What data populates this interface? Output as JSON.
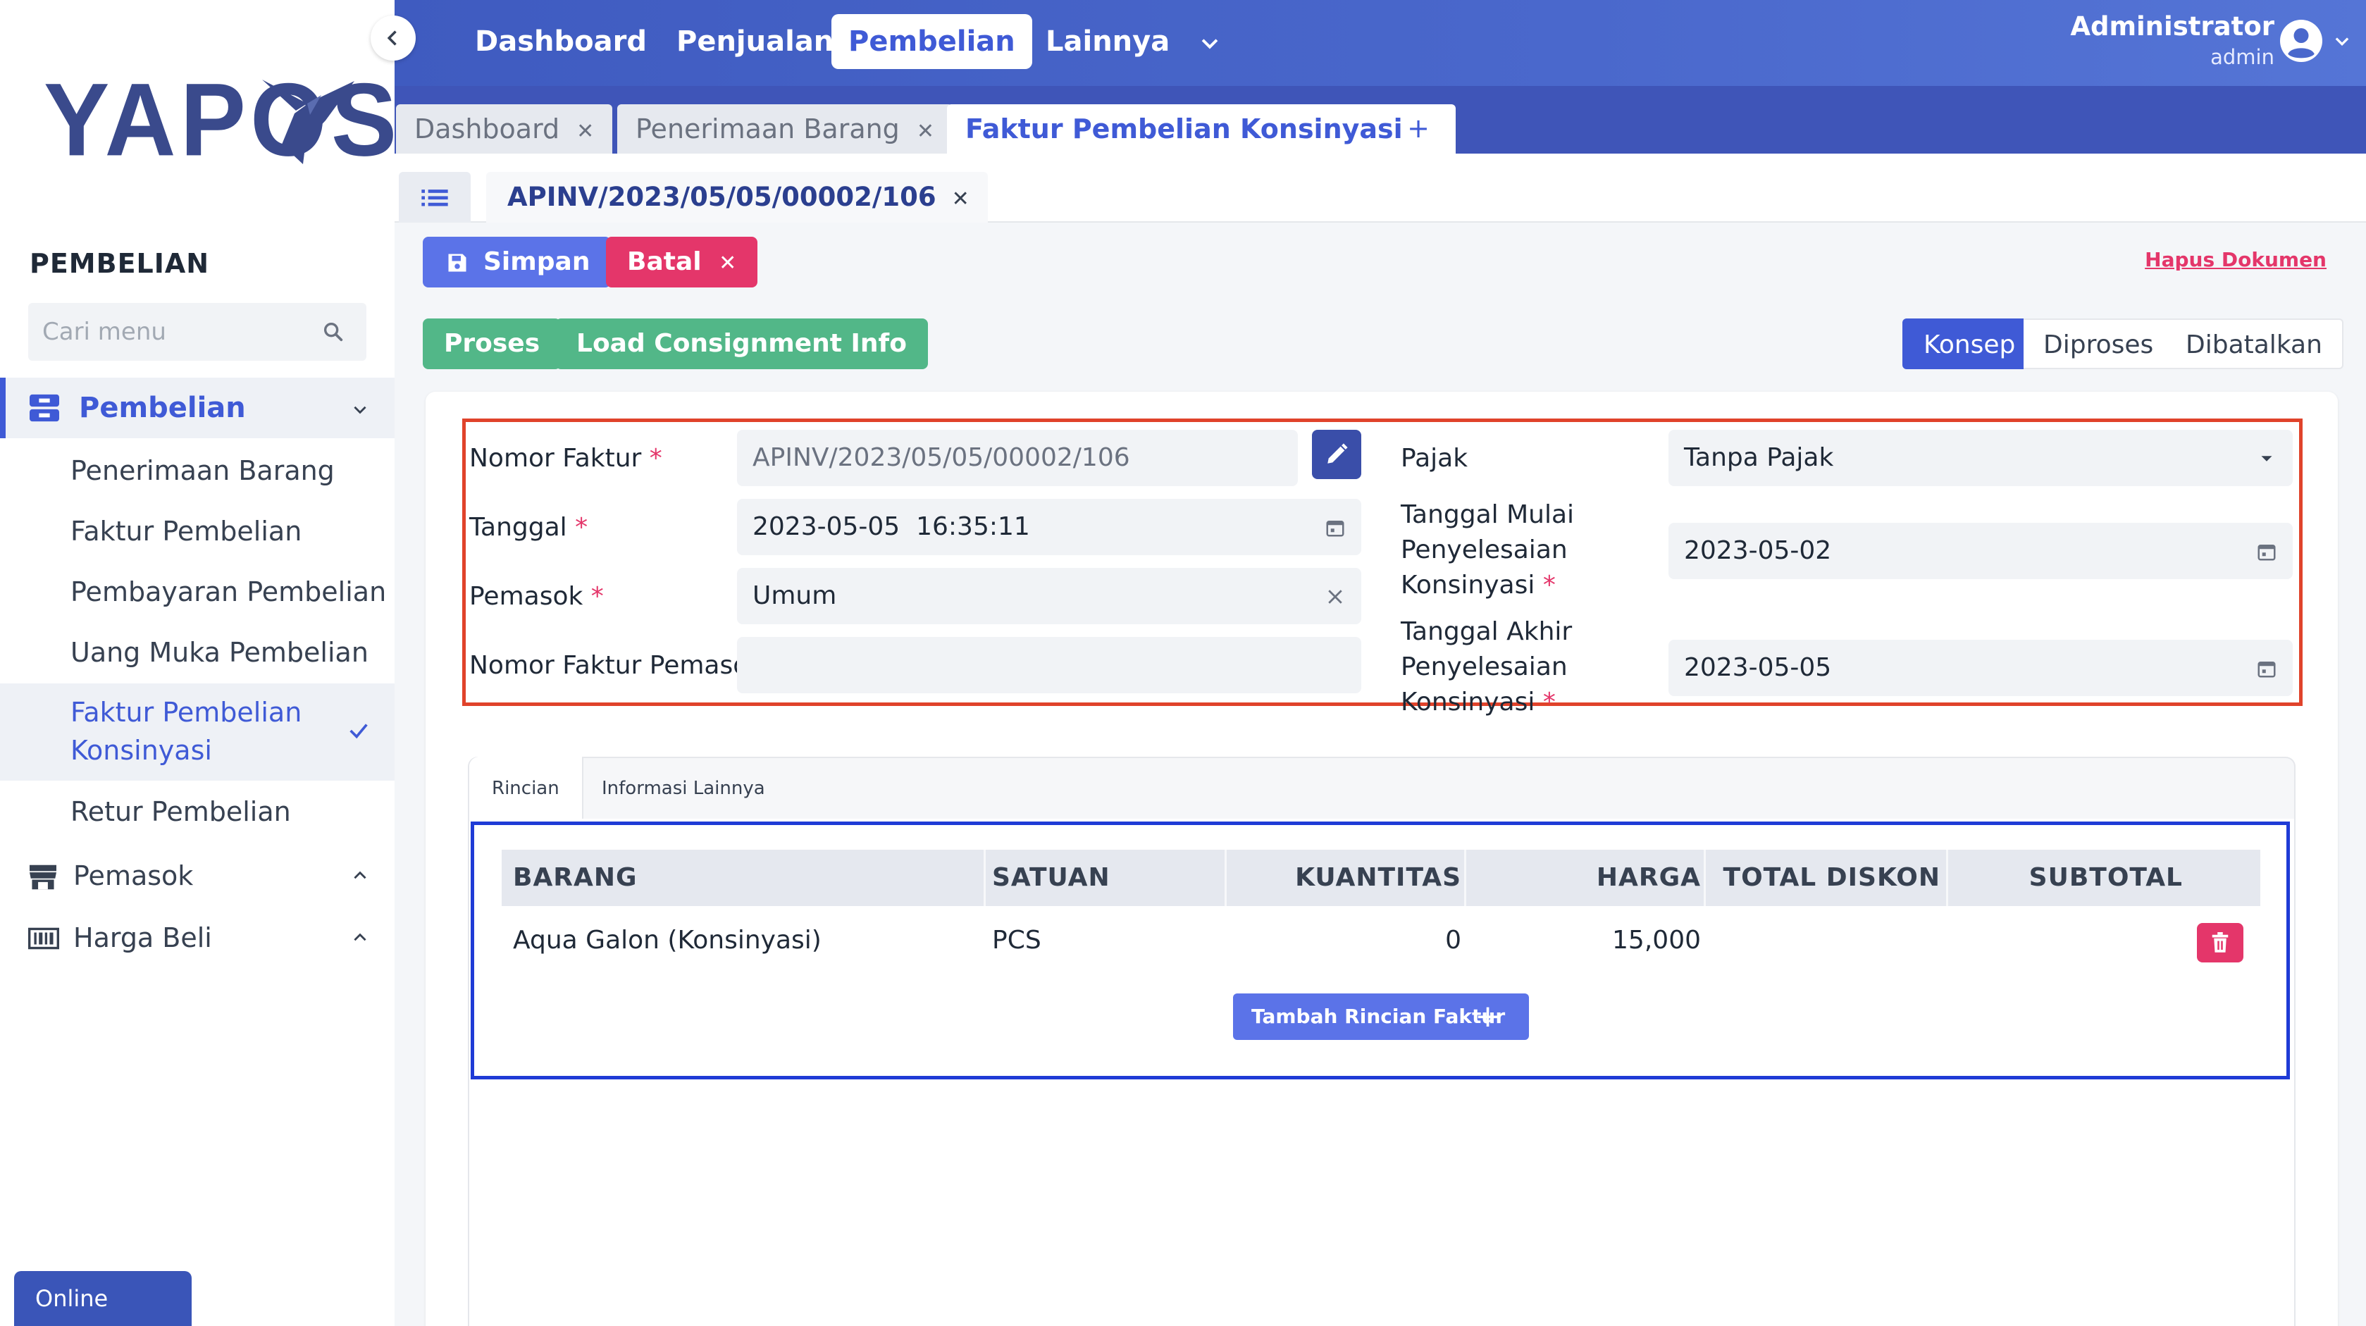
{
  "brand": {
    "logo_text": "YAPOS",
    "accent": "#3f5ad6",
    "logo_color": "#3a4a8c"
  },
  "sidebar": {
    "section_title": "PEMBELIAN",
    "search_placeholder": "Cari menu",
    "group_pembelian": "Pembelian",
    "items": [
      {
        "label": "Penerimaan Barang"
      },
      {
        "label": "Faktur Pembelian"
      },
      {
        "label": "Pembayaran Pembelian"
      },
      {
        "label": "Uang Muka Pembelian"
      },
      {
        "label": "Faktur Pembelian Konsinyasi",
        "line1": "Faktur Pembelian",
        "line2": "Konsinyasi",
        "active": true
      },
      {
        "label": "Retur Pembelian"
      }
    ],
    "group_pemasok": "Pemasok",
    "group_harga_beli": "Harga Beli"
  },
  "topnav": {
    "items": [
      "Dashboard",
      "Penjualan",
      "Pembelian",
      "Lainnya"
    ],
    "active": "Pembelian",
    "user_name": "Administrator",
    "user_role": "admin"
  },
  "doc_tabs": [
    {
      "label": "Dashboard"
    },
    {
      "label": "Penerimaan Barang"
    },
    {
      "label": "Faktur Pembelian Konsinyasi",
      "active": true
    }
  ],
  "add_tab_label": "+",
  "document_tab": "APINV/2023/05/05/00002/106",
  "actions": {
    "simpan": "Simpan",
    "batal": "Batal",
    "proses": "Proses",
    "load_consignment": "Load Consignment Info",
    "hapus_dokumen": "Hapus Dokumen"
  },
  "status_steps": [
    "Konsep",
    "Diproses",
    "Dibatalkan"
  ],
  "status_active": "Konsep",
  "form": {
    "nomor_faktur_label": "Nomor Faktur",
    "nomor_faktur_value": "APINV/2023/05/05/00002/106",
    "tanggal_label": "Tanggal",
    "tanggal_value": "2023-05-05  16:35:11",
    "pemasok_label": "Pemasok",
    "pemasok_value": "Umum",
    "nomor_faktur_pemasok_label": "Nomor Faktur Pemasok",
    "nomor_faktur_pemasok_value": "",
    "pajak_label": "Pajak",
    "pajak_value": "Tanpa Pajak",
    "tgl_mulai_label_l1": "Tanggal Mulai",
    "tgl_mulai_label_l2": "Penyelesaian",
    "tgl_mulai_label_l3": "Konsinyasi",
    "tgl_mulai_value": "2023-05-02",
    "tgl_akhir_label_l1": "Tanggal Akhir",
    "tgl_akhir_label_l2": "Penyelesaian",
    "tgl_akhir_label_l3": "Konsinyasi",
    "tgl_akhir_value": "2023-05-05",
    "required_mark": "*"
  },
  "detail_tabs": [
    "Rincian",
    "Informasi Lainnya"
  ],
  "table": {
    "columns": [
      "BARANG",
      "SATUAN",
      "KUANTITAS",
      "HARGA",
      "TOTAL DISKON",
      "SUBTOTAL"
    ],
    "rows": [
      {
        "barang": "Aqua Galon (Konsinyasi)",
        "satuan": "PCS",
        "kuantitas": "0",
        "harga": "15,000",
        "total_diskon": "",
        "subtotal": ""
      }
    ],
    "add_row_label": "Tambah Rincian Faktur"
  },
  "status_badge": "Online"
}
